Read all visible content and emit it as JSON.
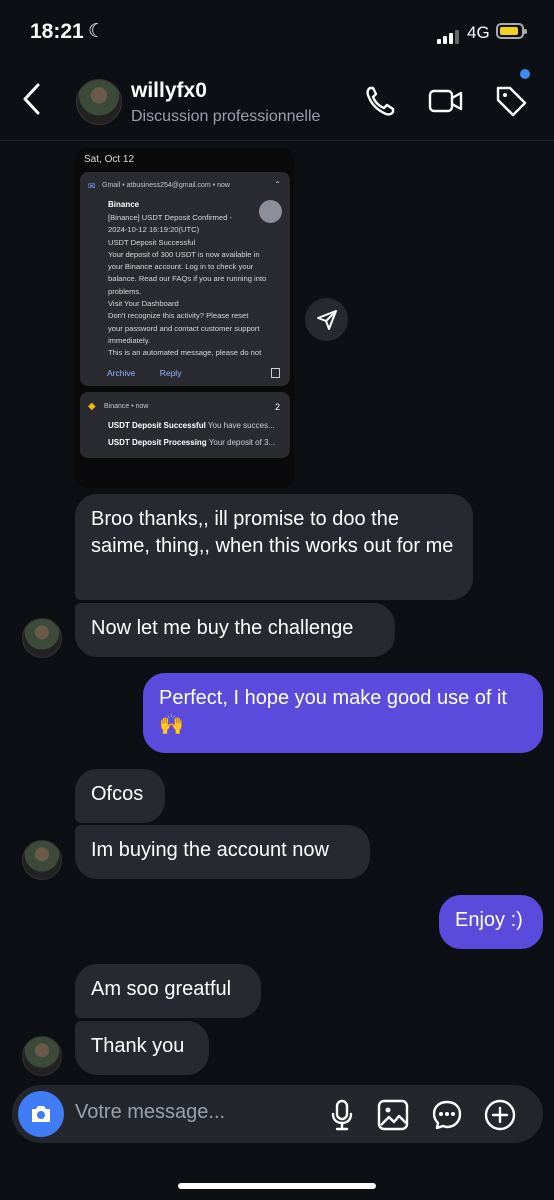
{
  "status_bar": {
    "time": "18:21",
    "network": "4G"
  },
  "header": {
    "name": "willyfx0",
    "subtitle": "Discussion professionnelle"
  },
  "shared_screenshot": {
    "date": "Sat, Oct 12",
    "gmail_notification": {
      "header": "Gmail • atbusiness254@gmail.com • now",
      "title": "Binance",
      "body_lines": [
        "[Binance] USDT Deposit Confirmed -",
        "2024-10-12 16:19:20(UTC)",
        "USDT Deposit Successful",
        "Your deposit of 300 USDT is now available in",
        "your Binance account. Log in to check your",
        "balance.  Read our FAQs if you are running into",
        "problems.",
        "Visit Your Dashboard",
        "Don't recognize this activity? Please reset",
        "your password and contact customer support",
        "immediately.",
        "This is an automated message, please do not"
      ],
      "actions": [
        "Archive",
        "Reply"
      ]
    },
    "binance_notification": {
      "header": "Binance • now",
      "count": "2",
      "rows": [
        {
          "bold": "USDT Deposit Successful",
          "rest": " You have succes..."
        },
        {
          "bold": "USDT Deposit Processing",
          "rest": " Your deposit of 3..."
        }
      ]
    }
  },
  "messages": [
    {
      "text": "Broo thanks,, ill promise to doo the saime, thing,, when this works out for me",
      "side": "in"
    },
    {
      "text": "Now let me buy the challenge",
      "side": "in"
    },
    {
      "text": "Perfect, I hope you make good use of it 🙌",
      "side": "out"
    },
    {
      "text": "Ofcos",
      "side": "in"
    },
    {
      "text": "Im buying the account now",
      "side": "in"
    },
    {
      "text": "Enjoy :)",
      "side": "out"
    },
    {
      "text": "Am soo greatful",
      "side": "in"
    },
    {
      "text": "Thank you",
      "side": "in"
    }
  ],
  "composer": {
    "placeholder": "Votre message..."
  },
  "colors": {
    "outgoing_bubble": "#5b4bdc",
    "incoming_bubble": "#262930",
    "camera_button": "#3f7cf6",
    "notification_dot": "#3b8cf0"
  }
}
